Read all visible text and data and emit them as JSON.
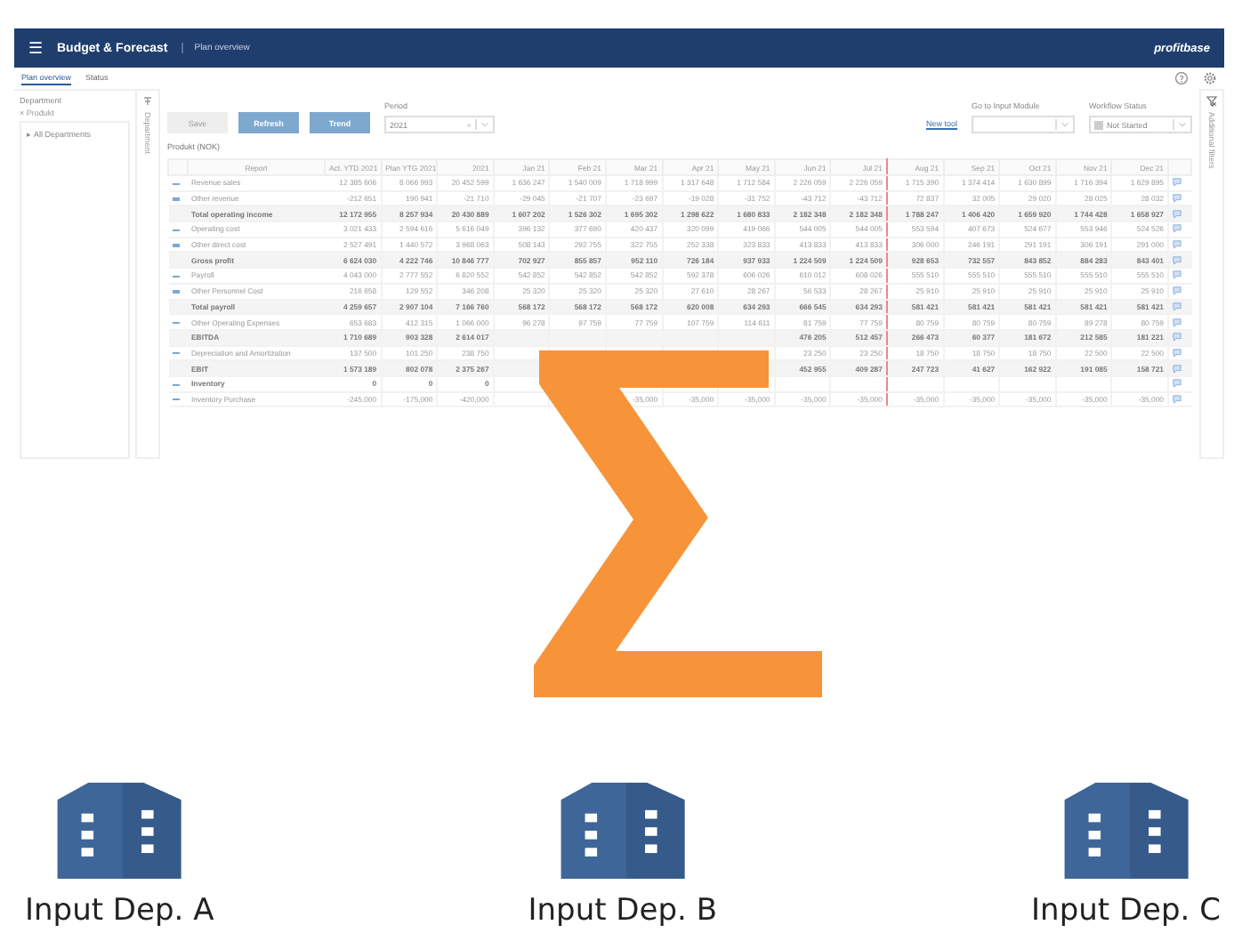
{
  "app": {
    "menu_icon": "☰",
    "title": "Budget & Forecast",
    "breadcrumb": "Plan overview",
    "logo": "profitbase"
  },
  "tabs": [
    {
      "label": "Plan overview",
      "selected": true
    },
    {
      "label": "Status",
      "selected": false
    }
  ],
  "sidebar": {
    "title": "Department",
    "filter_chip": "Produkt",
    "filter_remove": "×",
    "tree": [
      {
        "caret": "▸",
        "label": "All Departments",
        "expanded": false
      }
    ],
    "vertical_label": "Department"
  },
  "toolbar": {
    "buttons": [
      {
        "label": "Save",
        "disabled": true
      },
      {
        "label": "Refresh",
        "disabled": false
      },
      {
        "label": "Trend",
        "disabled": false
      }
    ],
    "period": {
      "label": "Period",
      "value": "2021",
      "clear": "×"
    },
    "link": "New tool",
    "input_module": {
      "label": "Go to Input Module"
    },
    "workflow": {
      "label": "Workflow Status",
      "value": "Not Started"
    }
  },
  "right_strip": {
    "label": "Additional filters"
  },
  "table": {
    "caption": "Produkt (NOK)",
    "columns": [
      {
        "label": "Report",
        "divider": false
      },
      {
        "label": "Act. YTD 2021",
        "divider": false
      },
      {
        "label": "Plan YTG 2021",
        "divider": false
      },
      {
        "label": "2021",
        "divider": false
      },
      {
        "label": "Jan 21",
        "divider": false
      },
      {
        "label": "Feb 21",
        "divider": false
      },
      {
        "label": "Mar 21",
        "divider": false
      },
      {
        "label": "Apr 21",
        "divider": false
      },
      {
        "label": "May 21",
        "divider": false
      },
      {
        "label": "Jun 21",
        "divider": false
      },
      {
        "label": "Jul 21",
        "divider": true
      },
      {
        "label": "Aug 21",
        "divider": false
      },
      {
        "label": "Sep 21",
        "divider": false
      },
      {
        "label": "Oct 21",
        "divider": false
      },
      {
        "label": "Nov 21",
        "divider": false
      },
      {
        "label": "Dec 21",
        "divider": false
      }
    ],
    "rows": [
      {
        "label": "Revenue sales",
        "kind": "line",
        "cells": {
          "1": "12 385 606",
          "2": "8 066 993",
          "3": "20 452 599",
          "4": "1 636 247",
          "5": "1 540 009",
          "6": "1 718 999",
          "7": "1 317 648",
          "8": "1 712 584",
          "9": "2 226 059",
          "10": "2 226 059",
          "11": "1 715 390",
          "12": "1 374 414",
          "13": "1 630 899",
          "14": "1 716 394",
          "15": "1 629 895"
        }
      },
      {
        "label": "Other revenue",
        "kind": "line",
        "cells": {
          "1": "-212 651",
          "2": "190 941",
          "3": "-21 710",
          "4": "-29 045",
          "5": "-21 707",
          "6": "-23 697",
          "7": "-19 028",
          "8": "-31 752",
          "9": "-43 712",
          "10": "-43 712",
          "11": "72 837",
          "12": "32 005",
          "13": "29 020",
          "14": "28 025",
          "15": "28 032"
        }
      },
      {
        "label": "Total operating income",
        "kind": "total",
        "cells": {
          "1": "12 172 955",
          "2": "8 257 934",
          "3": "20 430 889",
          "4": "1 607 202",
          "5": "1 526 302",
          "6": "1 695 302",
          "7": "1 298 622",
          "8": "1 680 833",
          "9": "2 182 348",
          "10": "2 182 348",
          "11": "1 788 247",
          "12": "1 406 420",
          "13": "1 659 920",
          "14": "1 744 428",
          "15": "1 658 927"
        }
      },
      {
        "label": "Operating cost",
        "kind": "line",
        "cells": {
          "1": "3 021 433",
          "2": "2 594 616",
          "3": "5 616 049",
          "4": "396 132",
          "5": "377 690",
          "6": "420 437",
          "7": "320 099",
          "8": "419 066",
          "9": "544 005",
          "10": "544 005",
          "11": "553 594",
          "12": "407 673",
          "13": "524 677",
          "14": "553 946",
          "15": "524 526"
        }
      },
      {
        "label": "Other direct cost",
        "kind": "line",
        "cells": {
          "1": "2 527 491",
          "2": "1 440 572",
          "3": "3 968 063",
          "4": "508 143",
          "5": "292 755",
          "6": "322 755",
          "7": "252 338",
          "8": "323 833",
          "9": "413 833",
          "10": "413 833",
          "11": "306 000",
          "12": "246 191",
          "13": "291 191",
          "14": "306 191",
          "15": "291 000"
        }
      },
      {
        "label": "Gross profit",
        "kind": "total",
        "cells": {
          "1": "6 624 030",
          "2": "4 222 746",
          "3": "10 846 777",
          "4": "702 927",
          "5": "855 857",
          "6": "952 110",
          "7": "726 184",
          "8": "937 933",
          "9": "1 224 509",
          "10": "1 224 509",
          "11": "928 653",
          "12": "732 557",
          "13": "843 852",
          "14": "884 283",
          "15": "843 401"
        }
      },
      {
        "label": "Payroll",
        "kind": "line",
        "cells": {
          "1": "4 043 000",
          "2": "2 777 552",
          "3": "6 820 552",
          "4": "542 852",
          "5": "542 852",
          "6": "542 852",
          "7": "592 378",
          "8": "606 026",
          "9": "610 012",
          "10": "608 026",
          "11": "555 510",
          "12": "555 510",
          "13": "555 510",
          "14": "555 510",
          "15": "555 510"
        }
      },
      {
        "label": "Other Personnel Cost",
        "kind": "line",
        "cells": {
          "1": "216 658",
          "2": "129 552",
          "3": "346 208",
          "4": "25 320",
          "5": "25 320",
          "6": "25 320",
          "7": "27 610",
          "8": "28 267",
          "9": "56 533",
          "10": "28 267",
          "11": "25 910",
          "12": "25 910",
          "13": "25 910",
          "14": "25 910",
          "15": "25 910"
        }
      },
      {
        "label": "Total payroll",
        "kind": "total",
        "cells": {
          "1": "4 259 657",
          "2": "2 907 104",
          "3": "7 166 760",
          "4": "568 172",
          "5": "568 172",
          "6": "568 172",
          "7": "620 008",
          "8": "634 293",
          "9": "666 545",
          "10": "634 293",
          "11": "581 421",
          "12": "581 421",
          "13": "581 421",
          "14": "581 421",
          "15": "581 421"
        }
      },
      {
        "label": "Other Operating Expenses",
        "kind": "line",
        "cells": {
          "1": "653 683",
          "2": "412 315",
          "3": "1 066 000",
          "4": "96 278",
          "5": "97 759",
          "6": "77 759",
          "7": "107 759",
          "8": "114 611",
          "9": "81 759",
          "10": "77 759",
          "11": "80 759",
          "12": "80 759",
          "13": "80 759",
          "14": "89 278",
          "15": "80 759"
        }
      },
      {
        "label": "EBITDA",
        "kind": "total",
        "cells": {
          "1": "1 710 689",
          "2": "903 328",
          "3": "2 614 017",
          "9": "476 205",
          "10": "512 457",
          "11": "266 473",
          "12": "60 377",
          "13": "181 672",
          "14": "212 585",
          "15": "181 221"
        }
      },
      {
        "label": "Depreciation and Amortization",
        "kind": "line",
        "cells": {
          "1": "137 500",
          "2": "101 250",
          "3": "238 750",
          "9": "23 250",
          "10": "23 250",
          "11": "18 750",
          "12": "18 750",
          "13": "18 750",
          "14": "22 500",
          "15": "22 500"
        }
      },
      {
        "label": "EBIT",
        "kind": "total",
        "cells": {
          "1": "1 573 189",
          "2": "802 078",
          "3": "2 375 267",
          "9": "452 955",
          "10": "409 287",
          "11": "247 723",
          "12": "41 627",
          "13": "162 922",
          "14": "191 085",
          "15": "158 721"
        }
      },
      {
        "label": "Inventory",
        "kind": "group",
        "cells": {
          "1": "0",
          "2": "0",
          "3": "0"
        }
      },
      {
        "label": "Inventory Purchase",
        "kind": "line",
        "cells": {
          "1": "-245,000",
          "2": "-175,000",
          "3": "-420,000",
          "6": "-35,000",
          "7": "-35,000",
          "8": "-35,000",
          "9": "-35,000",
          "10": "-35,000",
          "11": "-35,000",
          "12": "-35,000",
          "13": "-35,000",
          "14": "-35,000",
          "15": "-35,000"
        }
      }
    ]
  },
  "inputs": [
    {
      "label": "Input Dep. A"
    },
    {
      "label": "Input Dep. B"
    },
    {
      "label": "Input Dep. C"
    }
  ]
}
